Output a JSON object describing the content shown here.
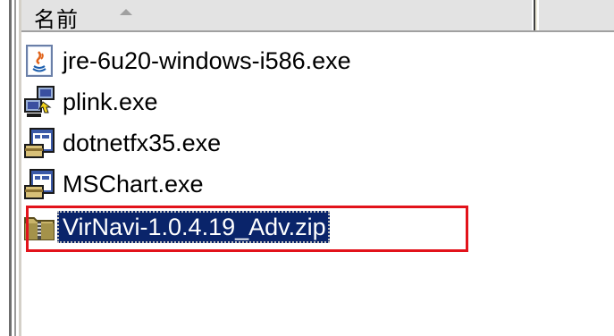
{
  "header": {
    "name_column_label": "名前",
    "sort_indicator": "sort-ascending-icon"
  },
  "files": [
    {
      "name": "jre-6u20-windows-i586.exe",
      "icon": "java-installer-icon",
      "selected": false
    },
    {
      "name": "plink.exe",
      "icon": "network-computer-icon",
      "selected": false
    },
    {
      "name": "dotnetfx35.exe",
      "icon": "setup-installer-icon",
      "selected": false
    },
    {
      "name": "MSChart.exe",
      "icon": "setup-installer-icon",
      "selected": false
    },
    {
      "name": "VirNavi-1.0.4.19_Adv.zip",
      "icon": "zip-folder-icon",
      "selected": true
    }
  ],
  "colors": {
    "selection_background": "#0a246a",
    "highlight_box": "#e2131b"
  }
}
